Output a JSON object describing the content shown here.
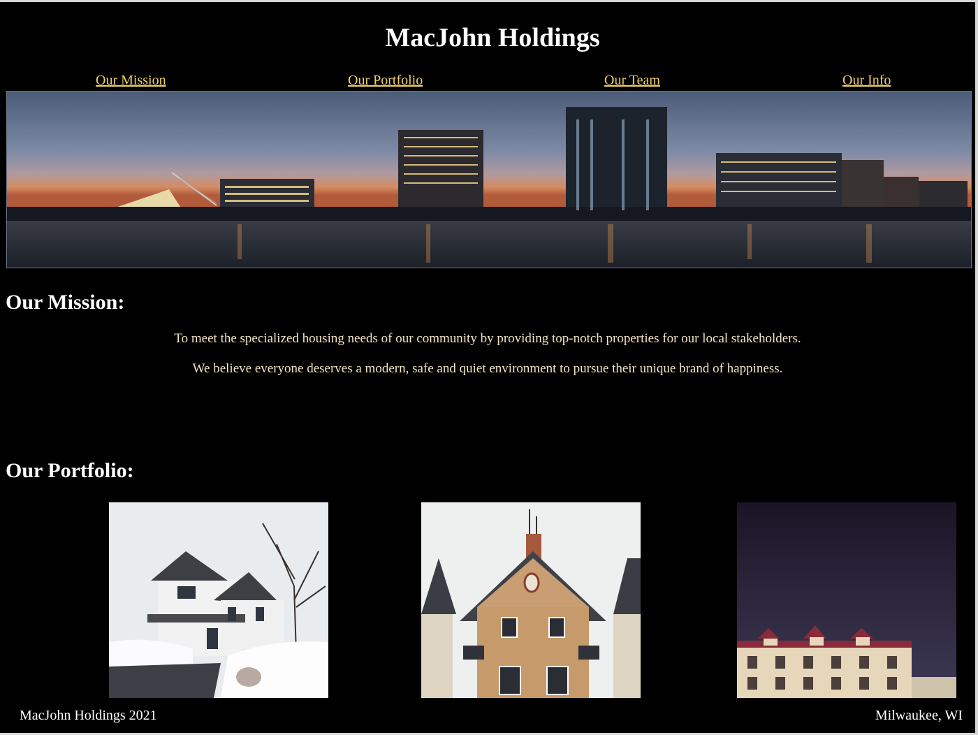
{
  "site": {
    "title": "MacJohn Holdings"
  },
  "nav": {
    "items": [
      {
        "label": "Our Mission"
      },
      {
        "label": "Our Portfolio"
      },
      {
        "label": "Our Team"
      },
      {
        "label": "Our Info"
      }
    ],
    "link_color": "#f2cf67"
  },
  "hero": {
    "image": "city-skyline-at-dusk"
  },
  "mission": {
    "heading": "Our Mission:",
    "paragraphs": [
      "To meet the specialized housing needs of our community by providing top-notch properties for our local stakeholders.",
      "We believe everyone deserves a modern, safe and quiet environment to pursue their unique brand of happiness."
    ],
    "text_color": "#f3e4c4"
  },
  "portfolio": {
    "heading": "Our Portfolio:",
    "photos": [
      {
        "image": "white-house-in-snow"
      },
      {
        "image": "brick-house"
      },
      {
        "image": "apartment-building-at-dusk"
      }
    ]
  },
  "footer": {
    "left": "MacJohn Holdings 2021",
    "right": "Milwaukee, WI"
  }
}
